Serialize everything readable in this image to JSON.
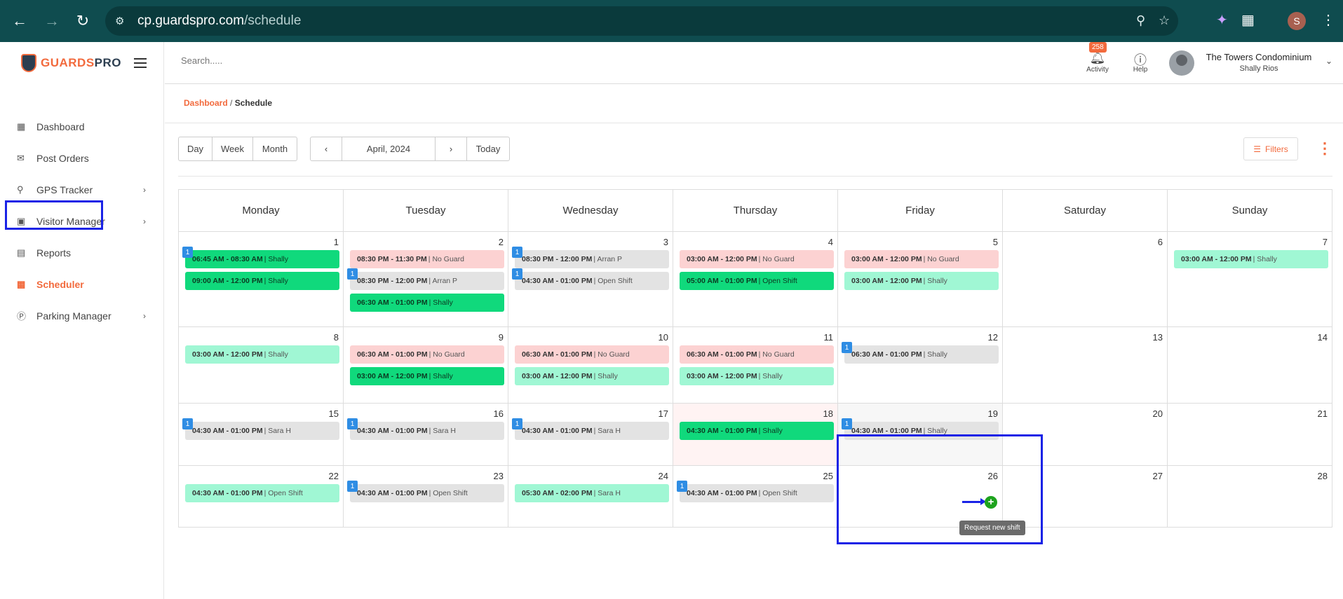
{
  "browser": {
    "url_host": "cp.guardspro.com",
    "url_path": "/schedule",
    "profile_initial": "S"
  },
  "brand": {
    "part1": "GUARDS",
    "part2": "PRO"
  },
  "sidebar": {
    "items": [
      {
        "label": "Dashboard",
        "icon": "grid-icon",
        "chevron": false
      },
      {
        "label": "Post Orders",
        "icon": "message-icon",
        "chevron": false
      },
      {
        "label": "GPS Tracker",
        "icon": "location-pin-icon",
        "chevron": true
      },
      {
        "label": "Visitor Manager",
        "icon": "id-card-icon",
        "chevron": true
      },
      {
        "label": "Reports",
        "icon": "document-icon",
        "chevron": false
      },
      {
        "label": "Scheduler",
        "icon": "calendar-icon",
        "chevron": false,
        "active": true
      },
      {
        "label": "Parking Manager",
        "icon": "parking-icon",
        "chevron": true
      }
    ]
  },
  "header": {
    "search_placeholder": "Search.....",
    "activity_label": "Activity",
    "activity_count": "258",
    "help_label": "Help",
    "org_name": "The Towers Condominium",
    "user_name": "Shally Rios"
  },
  "breadcrumb": {
    "parent": "Dashboard",
    "separator": " / ",
    "current": "Schedule"
  },
  "toolbar": {
    "views": [
      "Day",
      "Week",
      "Month"
    ],
    "period": "April, 2024",
    "today_label": "Today",
    "filters_label": "Filters"
  },
  "calendar": {
    "weekdays": [
      "Monday",
      "Tuesday",
      "Wednesday",
      "Thursday",
      "Friday",
      "Saturday",
      "Sunday"
    ],
    "weeks": [
      [
        {
          "day": "1",
          "shifts": [
            {
              "time": "06:45 AM - 08:30 AM",
              "person": "| Shally",
              "color": "dg",
              "badge": "1"
            },
            {
              "time": "09:00 AM - 12:00 PM",
              "person": "| Shally",
              "color": "dg"
            }
          ]
        },
        {
          "day": "2",
          "shifts": [
            {
              "time": "08:30 PM - 11:30 PM",
              "person": "| No Guard",
              "color": "pk"
            },
            {
              "time": "08:30 PM - 12:00 PM",
              "person": "| Arran P",
              "color": "gr",
              "badge": "1"
            },
            {
              "time": "06:30 AM - 01:00 PM",
              "person": "| Shally",
              "color": "dg"
            }
          ]
        },
        {
          "day": "3",
          "shifts": [
            {
              "time": "08:30 PM - 12:00 PM",
              "person": "| Arran P",
              "color": "gr",
              "badge": "1"
            },
            {
              "time": "04:30 AM - 01:00 PM",
              "person": "| Open Shift",
              "color": "gr",
              "badge": "1"
            }
          ]
        },
        {
          "day": "4",
          "shifts": [
            {
              "time": "03:00 AM - 12:00 PM",
              "person": "| No Guard",
              "color": "pk"
            },
            {
              "time": "05:00 AM - 01:00 PM",
              "person": "| Open Shift",
              "color": "dg"
            }
          ]
        },
        {
          "day": "5",
          "shifts": [
            {
              "time": "03:00 AM - 12:00 PM",
              "person": "| No Guard",
              "color": "pk"
            },
            {
              "time": "03:00 AM - 12:00 PM",
              "person": "| Shally",
              "color": "lg"
            }
          ]
        },
        {
          "day": "6",
          "shifts": []
        },
        {
          "day": "7",
          "shifts": [
            {
              "time": "03:00 AM - 12:00 PM",
              "person": "| Shally",
              "color": "lg"
            }
          ]
        }
      ],
      [
        {
          "day": "8",
          "shifts": [
            {
              "time": "03:00 AM - 12:00 PM",
              "person": "| Shally",
              "color": "lg"
            }
          ]
        },
        {
          "day": "9",
          "shifts": [
            {
              "time": "06:30 AM - 01:00 PM",
              "person": "| No Guard",
              "color": "pk"
            },
            {
              "time": "03:00 AM - 12:00 PM",
              "person": "| Shally",
              "color": "dg"
            }
          ]
        },
        {
          "day": "10",
          "shifts": [
            {
              "time": "06:30 AM - 01:00 PM",
              "person": "| No Guard",
              "color": "pk"
            },
            {
              "time": "03:00 AM - 12:00 PM",
              "person": "| Shally",
              "color": "lg"
            }
          ]
        },
        {
          "day": "11",
          "shifts": [
            {
              "time": "06:30 AM - 01:00 PM",
              "person": "| No Guard",
              "color": "pk"
            },
            {
              "time": "03:00 AM - 12:00 PM",
              "person": "| Shally",
              "color": "lg"
            }
          ]
        },
        {
          "day": "12",
          "shifts": [
            {
              "time": "06:30 AM - 01:00 PM",
              "person": "| Shally",
              "color": "gr",
              "badge": "1"
            }
          ]
        },
        {
          "day": "13",
          "shifts": []
        },
        {
          "day": "14",
          "shifts": []
        }
      ],
      [
        {
          "day": "15",
          "shifts": [
            {
              "time": "04:30 AM - 01:00 PM",
              "person": "| Sara H",
              "color": "gr",
              "badge": "1"
            }
          ]
        },
        {
          "day": "16",
          "shifts": [
            {
              "time": "04:30 AM - 01:00 PM",
              "person": "| Sara H",
              "color": "gr",
              "badge": "1"
            }
          ]
        },
        {
          "day": "17",
          "shifts": [
            {
              "time": "04:30 AM - 01:00 PM",
              "person": "| Sara H",
              "color": "gr",
              "badge": "1"
            }
          ]
        },
        {
          "day": "18",
          "today": true,
          "shifts": [
            {
              "time": "04:30 AM - 01:00 PM",
              "person": "| Shally",
              "color": "dg"
            }
          ]
        },
        {
          "day": "19",
          "hovered": true,
          "shifts": [
            {
              "time": "04:30 AM - 01:00 PM",
              "person": "| Shally",
              "color": "gr",
              "badge": "1"
            }
          ]
        },
        {
          "day": "20",
          "shifts": []
        },
        {
          "day": "21",
          "shifts": []
        }
      ],
      [
        {
          "day": "22",
          "shifts": [
            {
              "time": "04:30 AM - 01:00 PM",
              "person": "| Open Shift",
              "color": "lg"
            }
          ]
        },
        {
          "day": "23",
          "shifts": [
            {
              "time": "04:30 AM - 01:00 PM",
              "person": "| Open Shift",
              "color": "gr",
              "badge": "1"
            }
          ]
        },
        {
          "day": "24",
          "shifts": [
            {
              "time": "05:30 AM - 02:00 PM",
              "person": "| Sara H",
              "color": "lg"
            }
          ]
        },
        {
          "day": "25",
          "shifts": [
            {
              "time": "04:30 AM - 01:00 PM",
              "person": "| Open Shift",
              "color": "gr",
              "badge": "1"
            }
          ]
        },
        {
          "day": "26",
          "shifts": []
        },
        {
          "day": "27",
          "shifts": []
        },
        {
          "day": "28",
          "shifts": []
        }
      ]
    ]
  },
  "tooltip": {
    "text": "Request new shift"
  }
}
